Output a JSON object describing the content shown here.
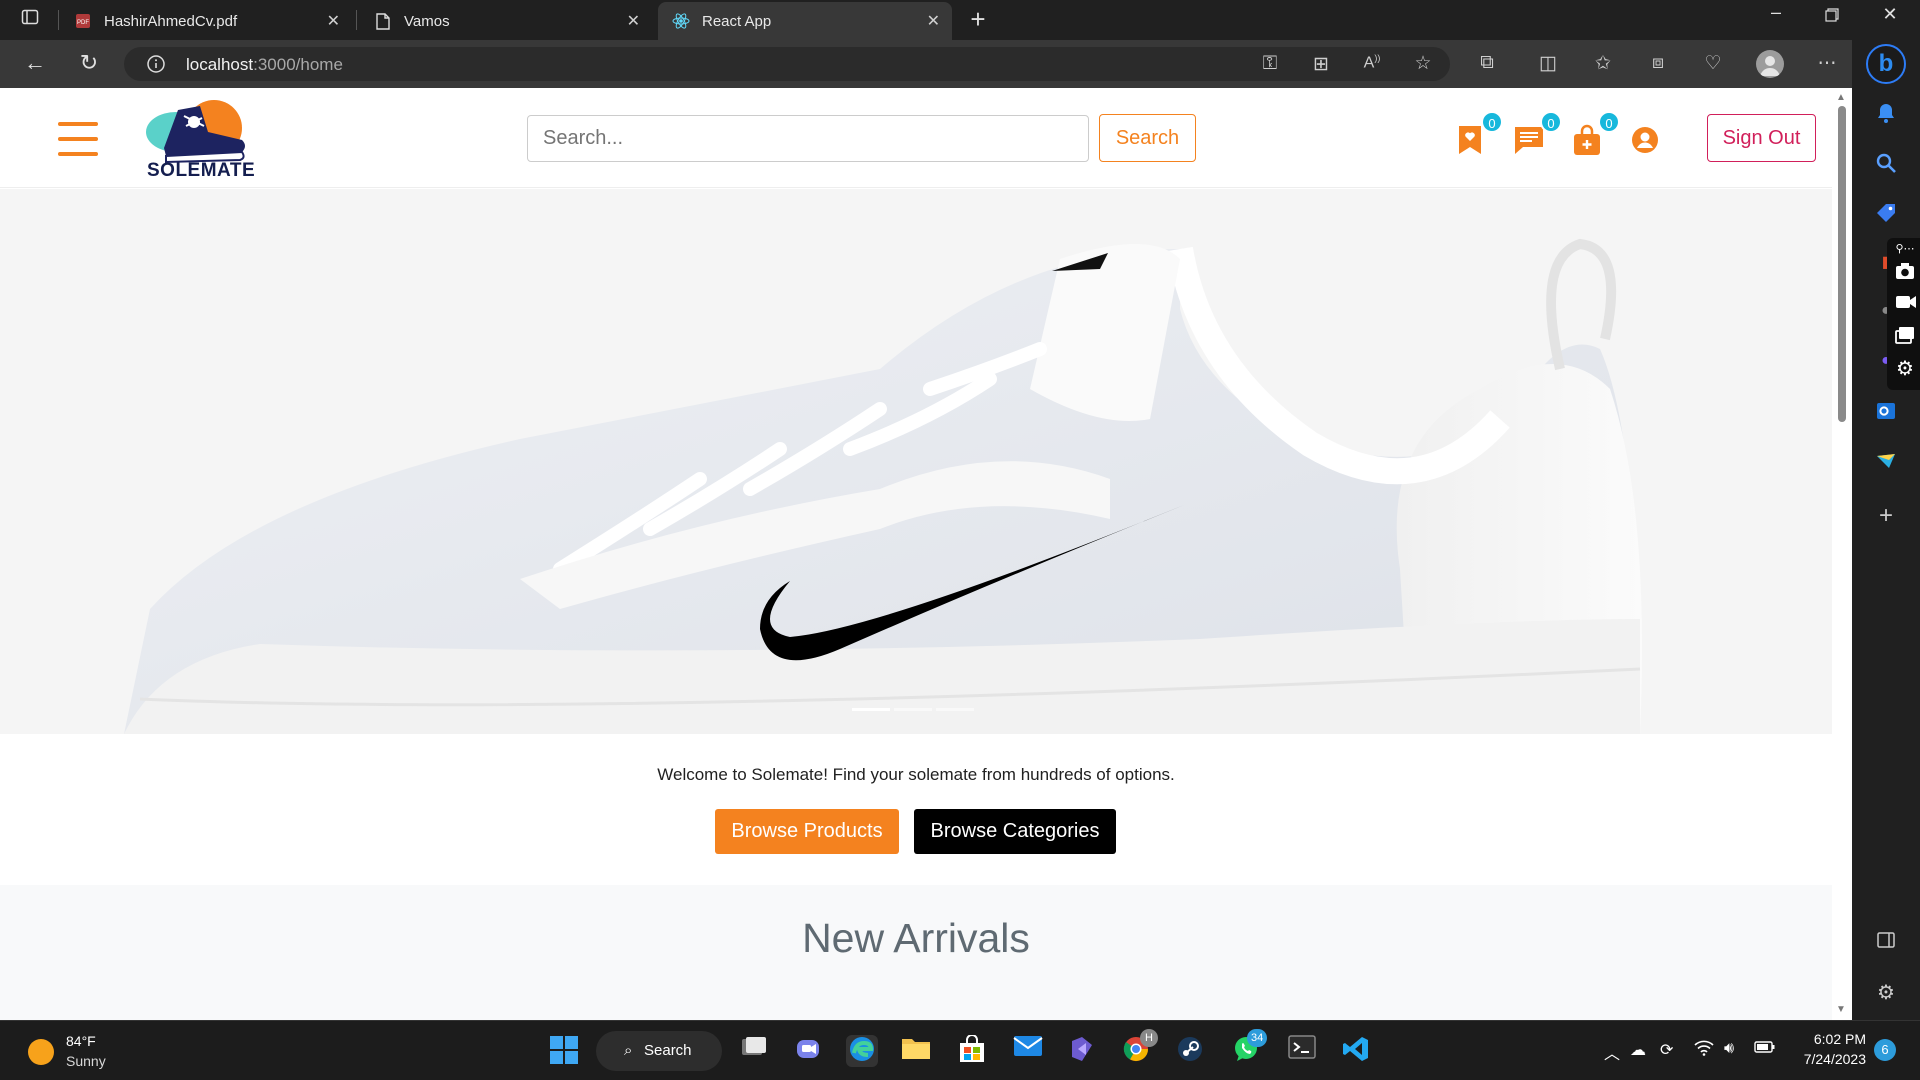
{
  "browser": {
    "tabs": [
      {
        "title": "HashirAhmedCv.pdf",
        "icon": "pdf-icon"
      },
      {
        "title": "Vamos",
        "icon": "page-icon"
      },
      {
        "title": "React App",
        "icon": "react-icon",
        "active": true
      }
    ],
    "url_host": "localhost",
    "url_path": ":3000/home"
  },
  "header": {
    "logo_text": "SOLEMATE",
    "search_placeholder": "Search...",
    "search_button": "Search",
    "wishlist_count": "0",
    "messages_count": "0",
    "cart_count": "0",
    "sign_out": "Sign Out"
  },
  "hero": {
    "slides": 3,
    "active_slide": 1
  },
  "main": {
    "welcome": "Welcome to Solemate! Find your solemate from hundreds of options.",
    "browse_products": "Browse Products",
    "browse_categories": "Browse Categories",
    "new_arrivals": "New Arrivals"
  },
  "taskbar": {
    "temperature": "84°F",
    "condition": "Sunny",
    "search_label": "Search",
    "whatsapp_badge": "34",
    "time": "6:02 PM",
    "date": "7/24/2023",
    "notifications": "6"
  },
  "colors": {
    "accent": "#f4821f",
    "signout": "#d11f5a",
    "badge": "#17b8dc"
  }
}
